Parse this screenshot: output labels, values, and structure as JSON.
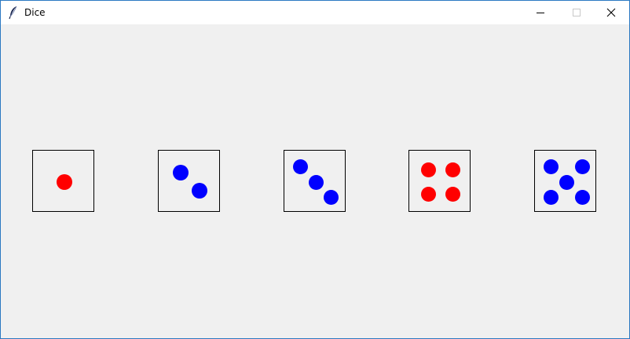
{
  "window": {
    "title": "Dice"
  },
  "controls": {
    "minimize": "minimize-icon",
    "maximize": "maximize-icon",
    "close": "close-icon"
  },
  "colors": {
    "red": "#ff0000",
    "blue": "#0000ff",
    "background": "#f0f0f0",
    "border": "#000000"
  },
  "dice": [
    {
      "value": 1,
      "color": "red"
    },
    {
      "value": 2,
      "color": "blue"
    },
    {
      "value": 3,
      "color": "blue"
    },
    {
      "value": 4,
      "color": "red"
    },
    {
      "value": 5,
      "color": "blue"
    }
  ]
}
